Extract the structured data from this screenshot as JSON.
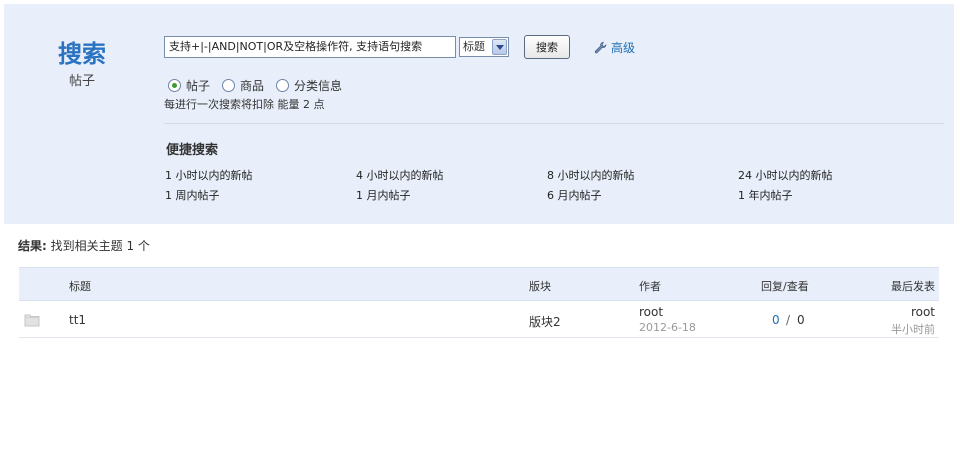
{
  "brand": {
    "title": "搜索",
    "subtitle": "帖子"
  },
  "search": {
    "input_value": "支持+|-|AND|NOT|OR及空格操作符, 支持语句搜索",
    "scope_selected": "标题",
    "button_label": "搜索",
    "advanced_label": "高级"
  },
  "types": [
    {
      "label": "帖子",
      "checked": true
    },
    {
      "label": "商品",
      "checked": false
    },
    {
      "label": "分类信息",
      "checked": false
    }
  ],
  "energy_note": "每进行一次搜索将扣除 能量 2 点",
  "quick": {
    "title": "便捷搜索",
    "links": [
      "1 小时以内的新帖",
      "4 小时以内的新帖",
      "8 小时以内的新帖",
      "24 小时以内的新帖",
      "1 周内帖子",
      "1 月内帖子",
      "6 月内帖子",
      "1 年内帖子"
    ]
  },
  "result": {
    "label": "结果:",
    "text": "找到相关主题 1 个"
  },
  "table": {
    "headers": {
      "title": "标题",
      "forum": "版块",
      "author": "作者",
      "replies_views": "回复/查看",
      "last_post": "最后发表"
    },
    "rows": [
      {
        "title": "tt1",
        "forum": "版块2",
        "author": "root",
        "date": "2012-6-18",
        "replies": "0",
        "separator": "/",
        "views": "0",
        "last_user": "root",
        "last_time": "半小时前"
      }
    ]
  },
  "colors": {
    "panel_bg": "#e8effa",
    "link_blue": "#1f6fb5",
    "brand_blue": "#2a73c2"
  }
}
